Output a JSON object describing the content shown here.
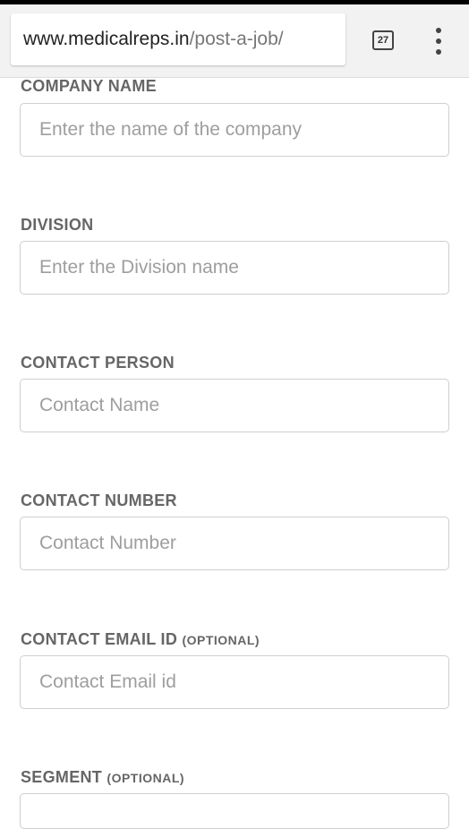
{
  "browser": {
    "url_host": "www.medicalreps.in",
    "url_path": "/post-a-job/",
    "tab_count": "27"
  },
  "form": {
    "company_name": {
      "label": "COMPANY NAME",
      "placeholder": "Enter the name of the company",
      "value": ""
    },
    "division": {
      "label": "DIVISION",
      "placeholder": "Enter the Division name",
      "value": ""
    },
    "contact_person": {
      "label": "CONTACT PERSON",
      "placeholder": "Contact Name",
      "value": ""
    },
    "contact_number": {
      "label": "CONTACT NUMBER",
      "placeholder": "Contact Number",
      "value": ""
    },
    "contact_email": {
      "label": "CONTACT EMAIL ID",
      "optional": "(OPTIONAL)",
      "placeholder": "Contact Email id",
      "value": ""
    },
    "segment": {
      "label": "SEGMENT",
      "optional": "(OPTIONAL)"
    }
  },
  "icons": {
    "tab_switcher": "tab-switcher-icon",
    "menu": "overflow-menu-icon"
  }
}
